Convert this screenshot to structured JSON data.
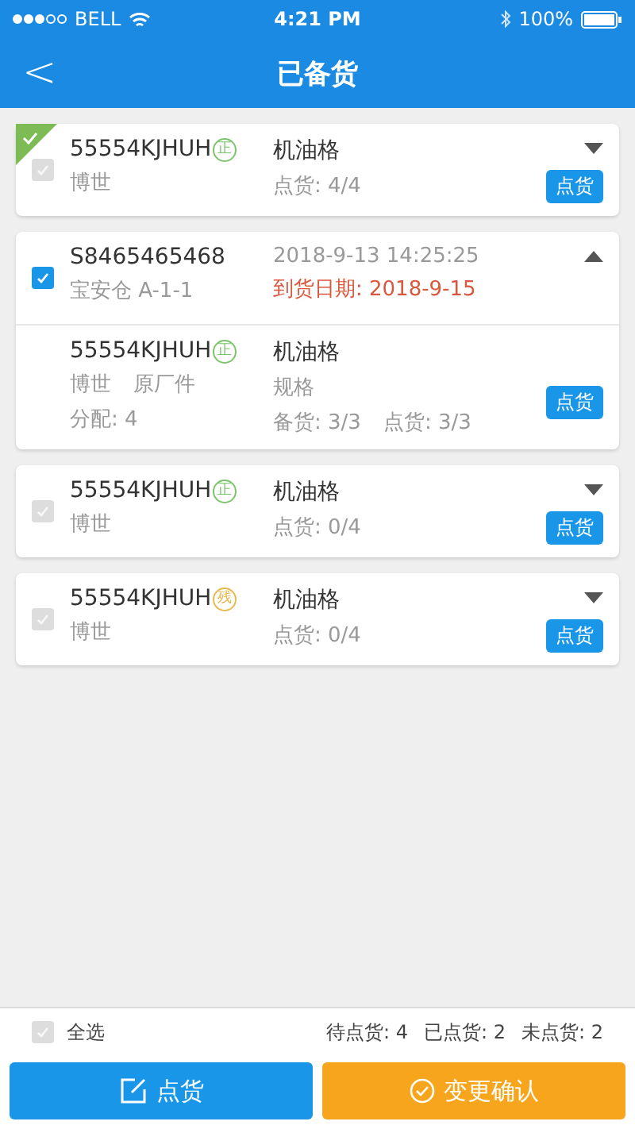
{
  "status_bar": {
    "carrier": "BELL",
    "time": "4:21 PM",
    "battery": "100%"
  },
  "nav": {
    "back": "<",
    "title": "已备货"
  },
  "cards": [
    {
      "kind": "item",
      "checked": false,
      "done": true,
      "expanded": false,
      "part": "55554KJHUH",
      "tag": {
        "text": "正",
        "color": "#7cc36b"
      },
      "name": "机油格",
      "brand": "博世",
      "count": "点货: 4/4",
      "button": "点货"
    },
    {
      "kind": "order",
      "checked": true,
      "done": false,
      "expanded": true,
      "order_no": "S8465465468",
      "time": "2018-9-13 14:25:25",
      "warehouse": "宝安仓 A-1-1",
      "arrival": "到货日期: 2018-9-15",
      "item": {
        "part": "55554KJHUH",
        "tag": {
          "text": "正",
          "color": "#7cc36b"
        },
        "name": "机油格",
        "brand": "博世",
        "origin": "原厂件",
        "spec": "规格",
        "alloc": "分配: 4",
        "stocked": "备货: 3/3",
        "count": "点货: 3/3",
        "button": "点货"
      }
    },
    {
      "kind": "item",
      "checked": false,
      "done": false,
      "expanded": false,
      "part": "55554KJHUH",
      "tag": {
        "text": "正",
        "color": "#7cc36b"
      },
      "name": "机油格",
      "brand": "博世",
      "count": "点货: 0/4",
      "button": "点货"
    },
    {
      "kind": "item",
      "checked": false,
      "done": false,
      "expanded": false,
      "part": "55554KJHUH",
      "tag": {
        "text": "残",
        "color": "#e8b84a"
      },
      "name": "机油格",
      "brand": "博世",
      "count": "点货: 0/4",
      "button": "点货"
    }
  ],
  "footer": {
    "select_all": {
      "label": "全选",
      "checked": false
    },
    "stats": [
      "待点货: 4",
      "已点货: 2",
      "未点货: 2"
    ],
    "buttons": [
      {
        "kind": "primary",
        "label": "点货"
      },
      {
        "kind": "confirm",
        "label": "变更确认"
      }
    ]
  }
}
